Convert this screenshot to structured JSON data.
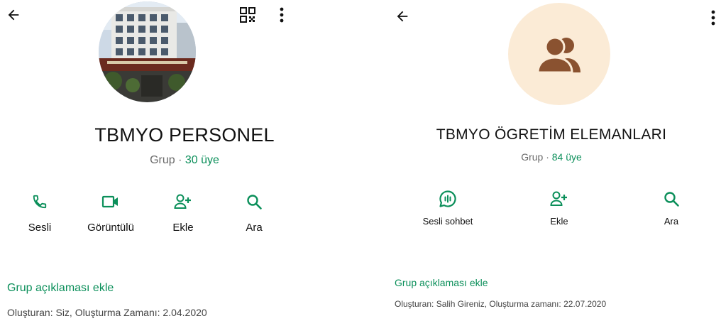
{
  "left": {
    "title": "TBMYO PERSONEL",
    "subtitle_prefix": "Grup · ",
    "members": "30 üye",
    "actions": [
      {
        "label": "Sesli",
        "icon": "phone-icon"
      },
      {
        "label": "Görüntülü",
        "icon": "video-icon"
      },
      {
        "label": "Ekle",
        "icon": "add-person-icon"
      },
      {
        "label": "Ara",
        "icon": "search-icon"
      }
    ],
    "description_link": "Grup açıklaması ekle",
    "created": "Oluşturan: Siz, Oluşturma Zamanı: 2.04.2020"
  },
  "right": {
    "title": "TBMYO ÖGRETİM ELEMANLARI",
    "subtitle_prefix": "Grup · ",
    "members": "84 üye",
    "actions": [
      {
        "label": "Sesli sohbet",
        "icon": "voice-chat-icon"
      },
      {
        "label": "Ekle",
        "icon": "add-person-icon"
      },
      {
        "label": "Ara",
        "icon": "search-icon"
      }
    ],
    "description_link": "Grup açıklaması ekle",
    "created": "Oluşturan: Salih Gireniz, Oluşturma zamanı: 22.07.2020"
  },
  "colors": {
    "accent_green": "#0b8f5a",
    "group_avatar_bg": "#fbebd6",
    "group_avatar_icon": "#8a5230",
    "text_secondary": "#6b6b6b"
  }
}
